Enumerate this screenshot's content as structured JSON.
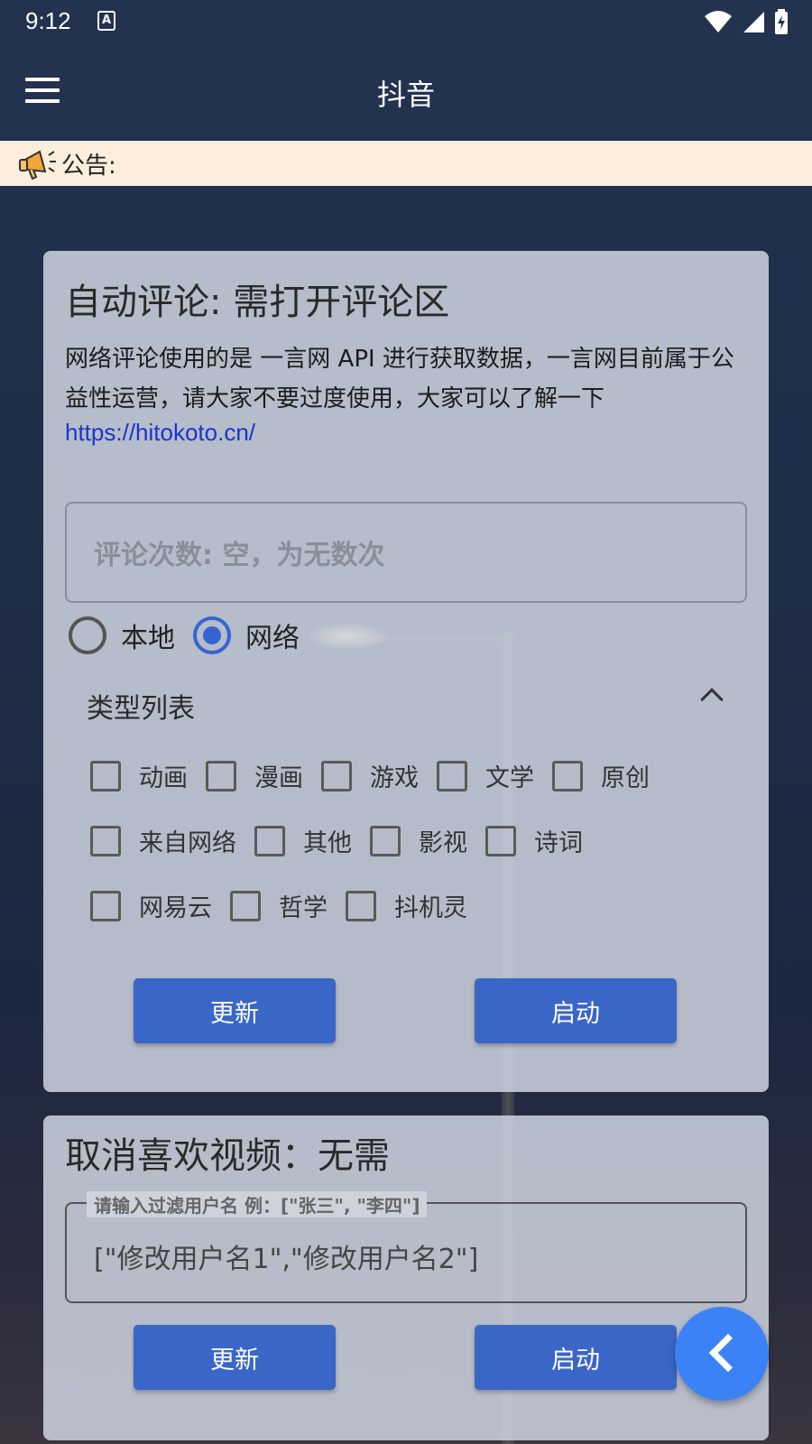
{
  "status_bar": {
    "time": "9:12",
    "notification_icon": "A"
  },
  "app_bar": {
    "title": "抖音"
  },
  "notice": {
    "label": "公告:"
  },
  "auto_comment": {
    "title": "自动评论: 需打开评论区",
    "description": "网络评论使用的是 一言网 API 进行获取数据，一言网目前属于公益性运营，请大家不要过度使用，大家可以了解一下",
    "link": "https://hitokoto.cn/",
    "count_placeholder": "评论次数: 空，为无数次",
    "radio_local": "本地",
    "radio_network": "网络",
    "selected_source": "网络",
    "type_list_title": "类型列表",
    "types_row1": [
      "动画",
      "漫画",
      "游戏",
      "文学",
      "原创"
    ],
    "types_row2": [
      "来自网络",
      "其他",
      "影视",
      "诗词"
    ],
    "types_row3": [
      "网易云",
      "哲学",
      "抖机灵"
    ],
    "update_button": "更新",
    "start_button": "启动"
  },
  "unlike_videos": {
    "title": "取消喜欢视频：无需",
    "filter_label": "请输入过滤用户名 例：[\"张三\", \"李四\"]",
    "filter_value": "[\"修改用户名1\",\"修改用户名2\"]",
    "update_button": "更新",
    "start_button": "启动"
  }
}
